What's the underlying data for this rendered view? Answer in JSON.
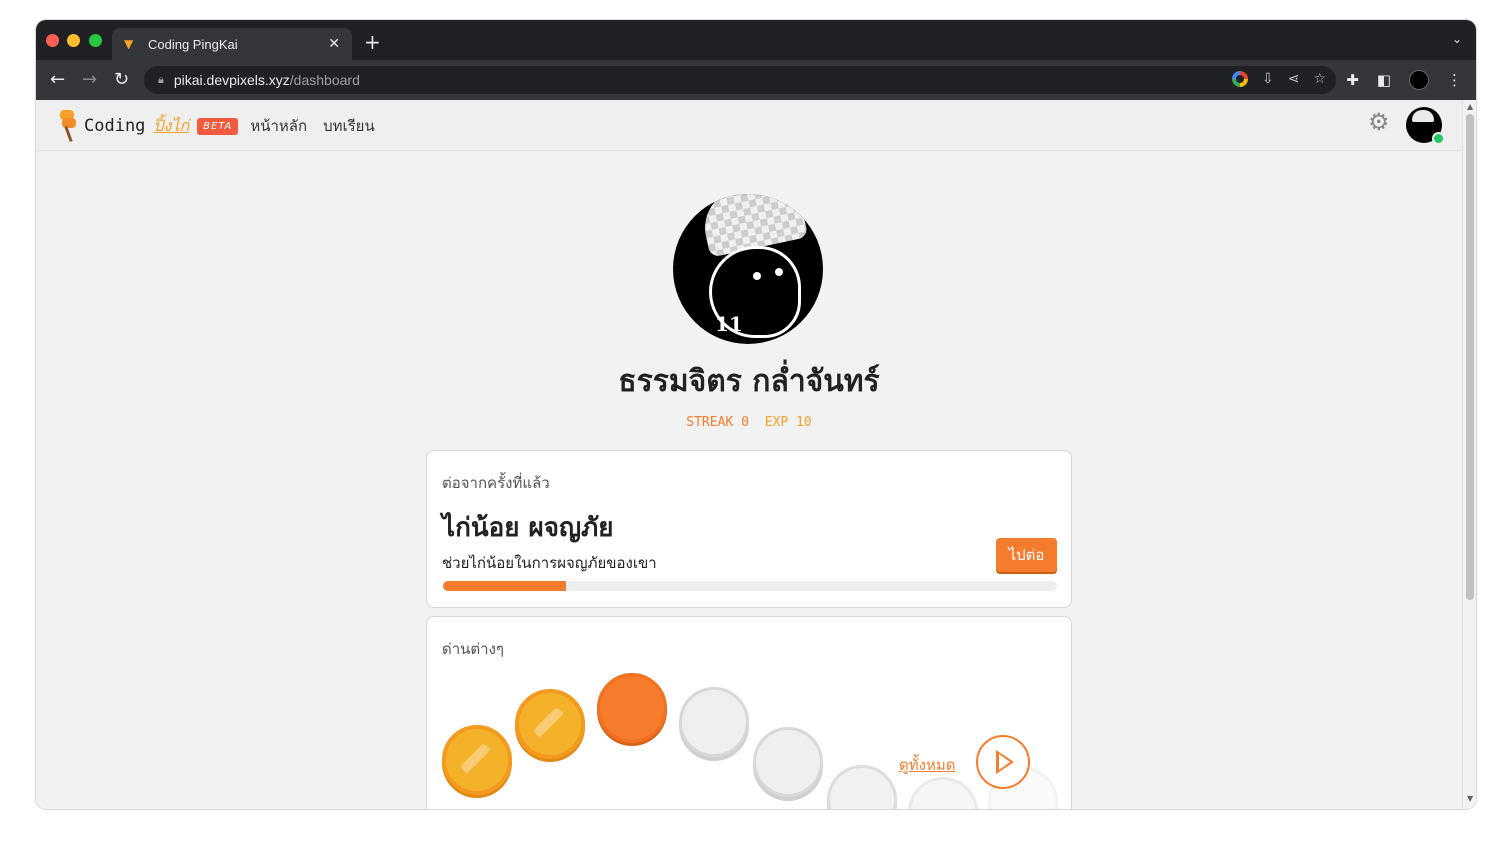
{
  "browser": {
    "tab_title": "Coding PingKai",
    "tab_close": "✕",
    "new_tab": "+",
    "url_host": "pikai.devpixels.xyz",
    "url_path": "/dashboard"
  },
  "nav": {
    "brand_word": "Coding",
    "brand_thai": "ปิ้งไก่",
    "beta": "BETA",
    "links": [
      "หน้าหลัก",
      "บทเรียน"
    ]
  },
  "profile": {
    "avatar_number": "11",
    "name": "ธรรมจิตร กล่ำจันทร์",
    "streak": "STREAK 0",
    "exp": "EXP 10"
  },
  "continue_card": {
    "label": "ต่อจากครั้งที่แล้ว",
    "lesson_title": "ไก่น้อย ผจญภัย",
    "lesson_desc": "ช่วยไก่น้อยในการผจญภัยของเขา",
    "button": "ไปต่อ",
    "progress_fraction": 0.2
  },
  "levels_card": {
    "label": "ด่านต่างๆ",
    "see_all": "ดูทั้งหมด",
    "levels": [
      "done",
      "done",
      "current",
      "locked",
      "locked",
      "locked",
      "locked",
      "locked"
    ]
  },
  "colors": {
    "accent": "#f47c2c",
    "gold": "#f4b12a",
    "beta": "#f15a3c",
    "online": "#22c55e"
  }
}
